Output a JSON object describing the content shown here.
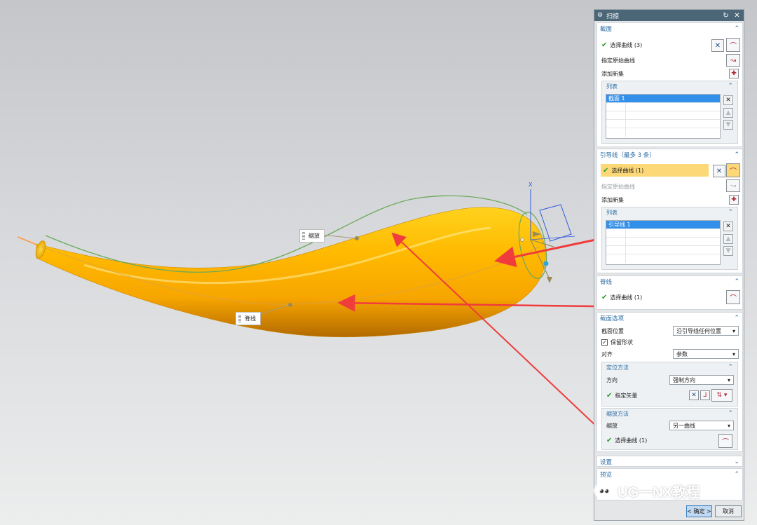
{
  "colors": {
    "accent": "#2b6ca3",
    "titlebar": "#4b6676",
    "highlight_row": "#fcd877",
    "list_selection": "#3390ea",
    "body_orange": "#f7a500",
    "guide_curve": "#6aaa5a",
    "annotation_arrow": "#f03c3c",
    "check": "#2a9d2a"
  },
  "viewport": {
    "label_scale": "缩放",
    "label_spine": "脊线",
    "triad_axis": "X"
  },
  "dialog": {
    "title": "扫掠",
    "title_icon": "gear-icon",
    "reset_icon": "reset-icon",
    "close_icon": "close-icon",
    "section_profile": {
      "title": "截面",
      "select_curve": "选择曲线 (3)",
      "specify_origin": "指定原始曲线",
      "add_new_set": "添加新集",
      "list_title": "列表",
      "list_item": "截面 1"
    },
    "section_guide": {
      "title": "引导线（最多 3 条）",
      "select_curve": "选择曲线 (1)",
      "specify_origin": "指定原始曲线",
      "add_new_set": "添加新集",
      "list_title": "列表",
      "list_item": "引导线 1"
    },
    "section_spine": {
      "title": "脊线",
      "select_curve": "选择曲线 (1)"
    },
    "section_options": {
      "title": "截面选项",
      "position_label": "截面位置",
      "position_value": "沿引导线任何位置",
      "preserve_shape": "保留形状",
      "preserve_checked": true,
      "align_label": "对齐",
      "align_value": "参数",
      "orientation_title": "定位方法",
      "direction_label": "方向",
      "direction_value": "强制方向",
      "specify_vector": "指定矢量",
      "scaling_title": "缩放方法",
      "scaling_label": "缩放",
      "scaling_value": "另一曲线",
      "select_curve": "选择曲线 (1)"
    },
    "section_settings": {
      "title": "设置"
    },
    "section_preview": {
      "title": "预览"
    },
    "ok_label": "< 确定 >",
    "cancel_label": "取消"
  },
  "watermark": "UG一NX教程"
}
